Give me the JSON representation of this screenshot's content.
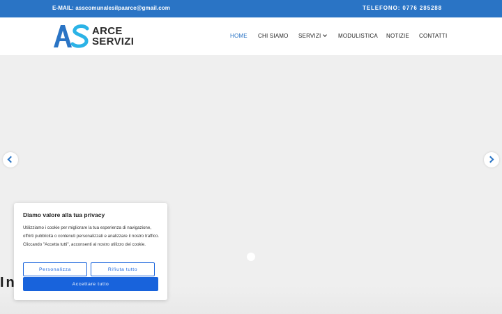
{
  "topbar": {
    "email": "E-MAIL: asscomunalesilpaarce@gmail.com",
    "phone": "TELEFONO: 0776 285288"
  },
  "logo": {
    "mark": "AS",
    "line1": "ARCE",
    "line2": "SERVIZI",
    "colors": {
      "a": "#2a74c5",
      "s": "#2bb3e6"
    }
  },
  "nav": {
    "items": [
      {
        "label": "HOME",
        "active": true
      },
      {
        "label": "CHI SIAMO"
      },
      {
        "label": "SERVIZI",
        "has_dropdown": true
      },
      {
        "label": "MODULISTICA"
      },
      {
        "label": "NOTIZIE"
      },
      {
        "label": "CONTATTI"
      }
    ]
  },
  "hero": {
    "text": "In"
  },
  "icons": {
    "prev": "chevron-left-icon",
    "next": "chevron-right-icon",
    "dropdown": "chevron-down-icon"
  },
  "cookie": {
    "title": "Diamo valore alla tua privacy",
    "body": "Utilizziamo i cookie per migliorare la tua esperienza di navigazione, offrirti pubblicità o contenuti personalizzati e analizzare il nostro traffico. Cliccando \"Accetta tutti\", acconsenti al nostro utilizzo dei cookie.",
    "customize_label": "Personalizza",
    "reject_label": "Rifiuta tutto",
    "accept_label": "Accettare tutto"
  },
  "colors": {
    "accent": "#2a74c5",
    "button": "#1863dc"
  }
}
